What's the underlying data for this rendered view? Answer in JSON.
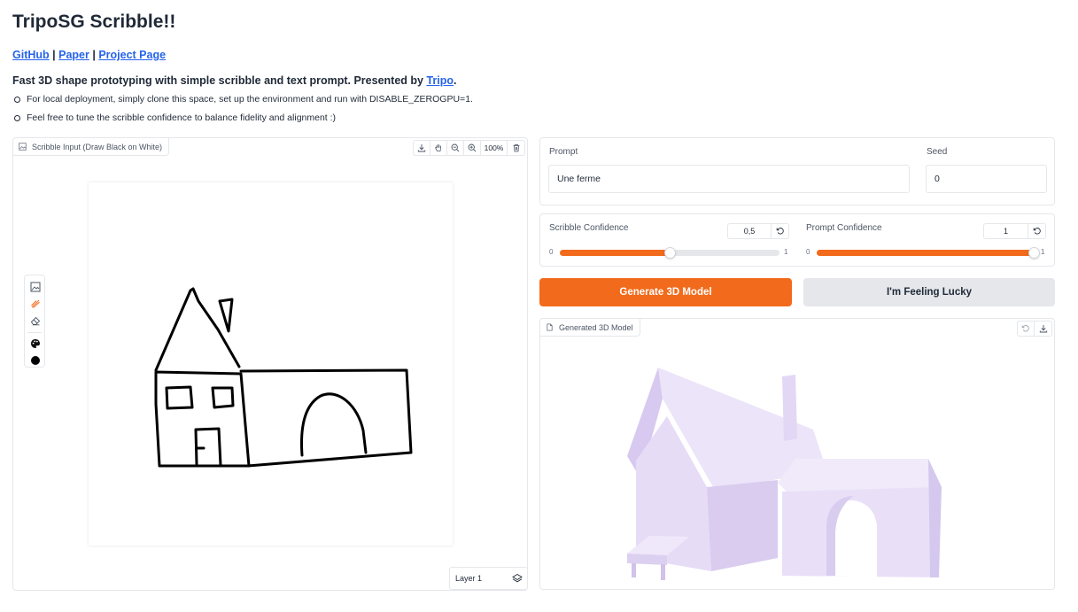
{
  "header": {
    "title": "TripoSG Scribble!!",
    "links": [
      {
        "label": "GitHub"
      },
      {
        "label": "Paper"
      },
      {
        "label": "Project Page"
      }
    ],
    "separator": " | ",
    "description_prefix": "Fast 3D shape prototyping with simple scribble and text prompt. Presented by ",
    "description_link": "Tripo",
    "description_suffix": ".",
    "bullets": [
      "For local deployment, simply clone this space, set up the environment and run with DISABLE_ZEROGPU=1.",
      "Feel free to tune the scribble confidence to balance fidelity and alignment :)"
    ]
  },
  "scribble": {
    "label": "Scribble Input (Draw Black on White)",
    "zoom": "100%",
    "layer": "Layer 1",
    "tools": [
      "image-icon",
      "brush-icon",
      "eraser-icon",
      "palette-icon",
      "color-dot-icon"
    ],
    "colors": {
      "stroke": "#000000"
    }
  },
  "prompt": {
    "label": "Prompt",
    "value": "Une ferme",
    "seed_label": "Seed",
    "seed_value": "0"
  },
  "sliders": {
    "scribble": {
      "label": "Scribble Confidence",
      "value": "0,5",
      "min": "0",
      "max": "1",
      "fraction": 0.5
    },
    "prompt": {
      "label": "Prompt Confidence",
      "value": "1",
      "min": "0",
      "max": "1",
      "fraction": 1.0
    }
  },
  "buttons": {
    "generate": "Generate 3D Model",
    "lucky": "I'm Feeling Lucky"
  },
  "output": {
    "label": "Generated 3D Model"
  },
  "colors": {
    "accent": "#f26a1b",
    "link": "#2563eb",
    "model": "#e6dcf6"
  }
}
